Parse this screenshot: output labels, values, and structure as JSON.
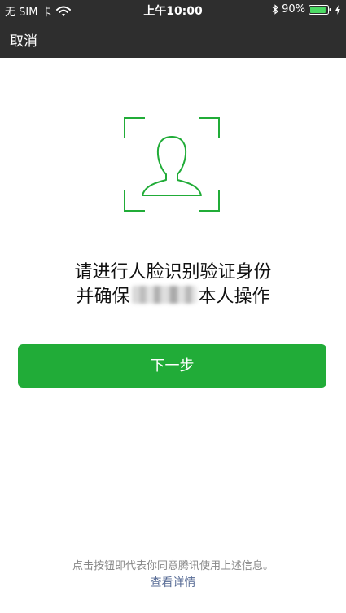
{
  "status_bar": {
    "carrier": "无 SIM 卡",
    "time": "上午10:00",
    "battery_percent": "90%",
    "battery_level": 0.9,
    "icons": [
      "wifi-icon",
      "bluetooth-icon",
      "battery-icon",
      "charging-icon"
    ]
  },
  "nav": {
    "cancel_label": "取消"
  },
  "main": {
    "face_icon": "face-outline-icon",
    "title_line1": "请进行人脸识别验证身份",
    "title_line2_prefix": "并确保",
    "title_line2_suffix": "本人操作",
    "next_label": "下一步"
  },
  "footer": {
    "notice": "点击按钮即代表你同意腾讯使用上述信息。",
    "details_label": "查看详情"
  },
  "colors": {
    "header_bg": "#2e2e2e",
    "accent_green": "#21ac38",
    "link_blue": "#576b95",
    "muted_text": "#888888"
  }
}
